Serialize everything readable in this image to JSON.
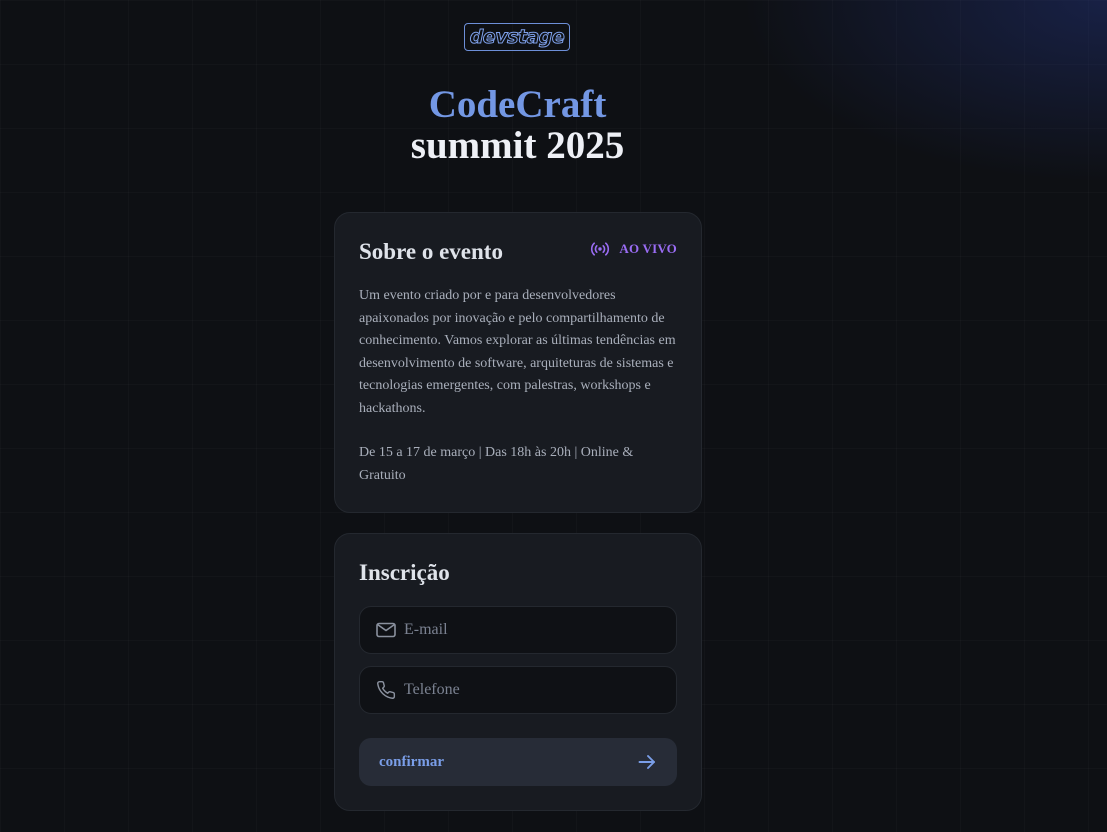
{
  "logo": {
    "text": "devstage"
  },
  "hero": {
    "line1": "CodeCraft",
    "line2": "summit 2025"
  },
  "about": {
    "title": "Sobre o evento",
    "live_icon": "live-broadcast-icon",
    "live_label": "AO VIVO",
    "description": "Um evento criado por e para desenvolvedores apaixonados por inovação e pelo compartilhamento de conhecimento. Vamos explorar as últimas tendências em desenvolvimento de software, arquiteturas de sistemas e tecnologias emergentes, com palestras, workshops e hackathons.",
    "info": "De 15 a 17 de março | Das 18h às 20h | Online & Gratuito"
  },
  "signup": {
    "title": "Inscrição",
    "email": {
      "icon": "mail-icon",
      "placeholder": "E-mail",
      "value": ""
    },
    "phone": {
      "icon": "phone-icon",
      "placeholder": "Telefone",
      "value": ""
    },
    "submit": {
      "label": "confirmar",
      "icon": "arrow-right-icon"
    }
  },
  "colors": {
    "background": "#0e1014",
    "card": "#181b21",
    "accent_blue": "#7397e4",
    "live_purple": "#9a6cf4",
    "button": "#272c37"
  }
}
